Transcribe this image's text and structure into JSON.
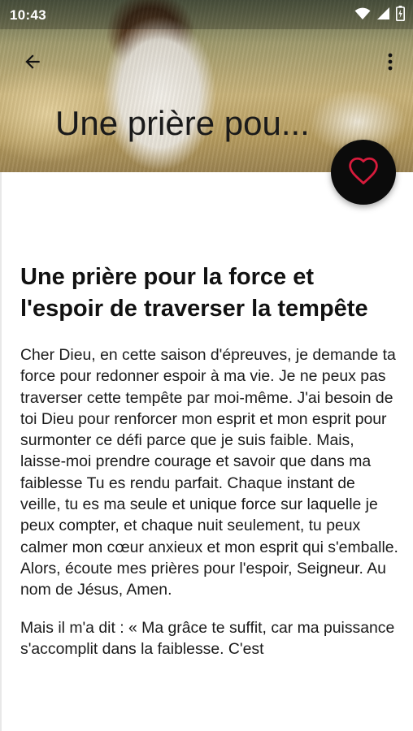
{
  "status_bar": {
    "time": "10:43",
    "icons": [
      "wifi-icon",
      "cellular-signal-icon",
      "battery-icon"
    ]
  },
  "toolbar": {
    "back_icon": "arrow-back-icon",
    "overflow_icon": "more-vertical-icon"
  },
  "header": {
    "collapsed_title": "Une prière pou...",
    "image": "child-praying-in-wheat-field"
  },
  "fab": {
    "icon": "heart-outline-icon",
    "icon_color": "#d81b3c",
    "background": "#0b0b0b"
  },
  "article": {
    "title": "Une prière pour la force et l'espoir de traverser la tempête",
    "paragraphs": [
      "Cher Dieu, en cette saison d'épreuves, je demande ta force pour redonner espoir à ma vie. Je ne peux pas traverser cette tempête par moi-même. J'ai besoin de toi Dieu pour renforcer mon esprit et mon esprit pour surmonter ce défi parce que je suis faible. Mais, laisse-moi prendre courage et savoir que dans ma faiblesse Tu es rendu parfait. Chaque instant de veille, tu es ma seule et unique force sur laquelle je peux compter, et chaque nuit seulement, tu peux calmer mon cœur anxieux et mon esprit qui s'emballe. Alors, écoute mes prières pour l'espoir, Seigneur. Au nom de Jésus, Amen.",
      "Mais il m'a dit : « Ma grâce te suffit, car ma puissance s'accomplit dans la faiblesse. C'est"
    ]
  }
}
